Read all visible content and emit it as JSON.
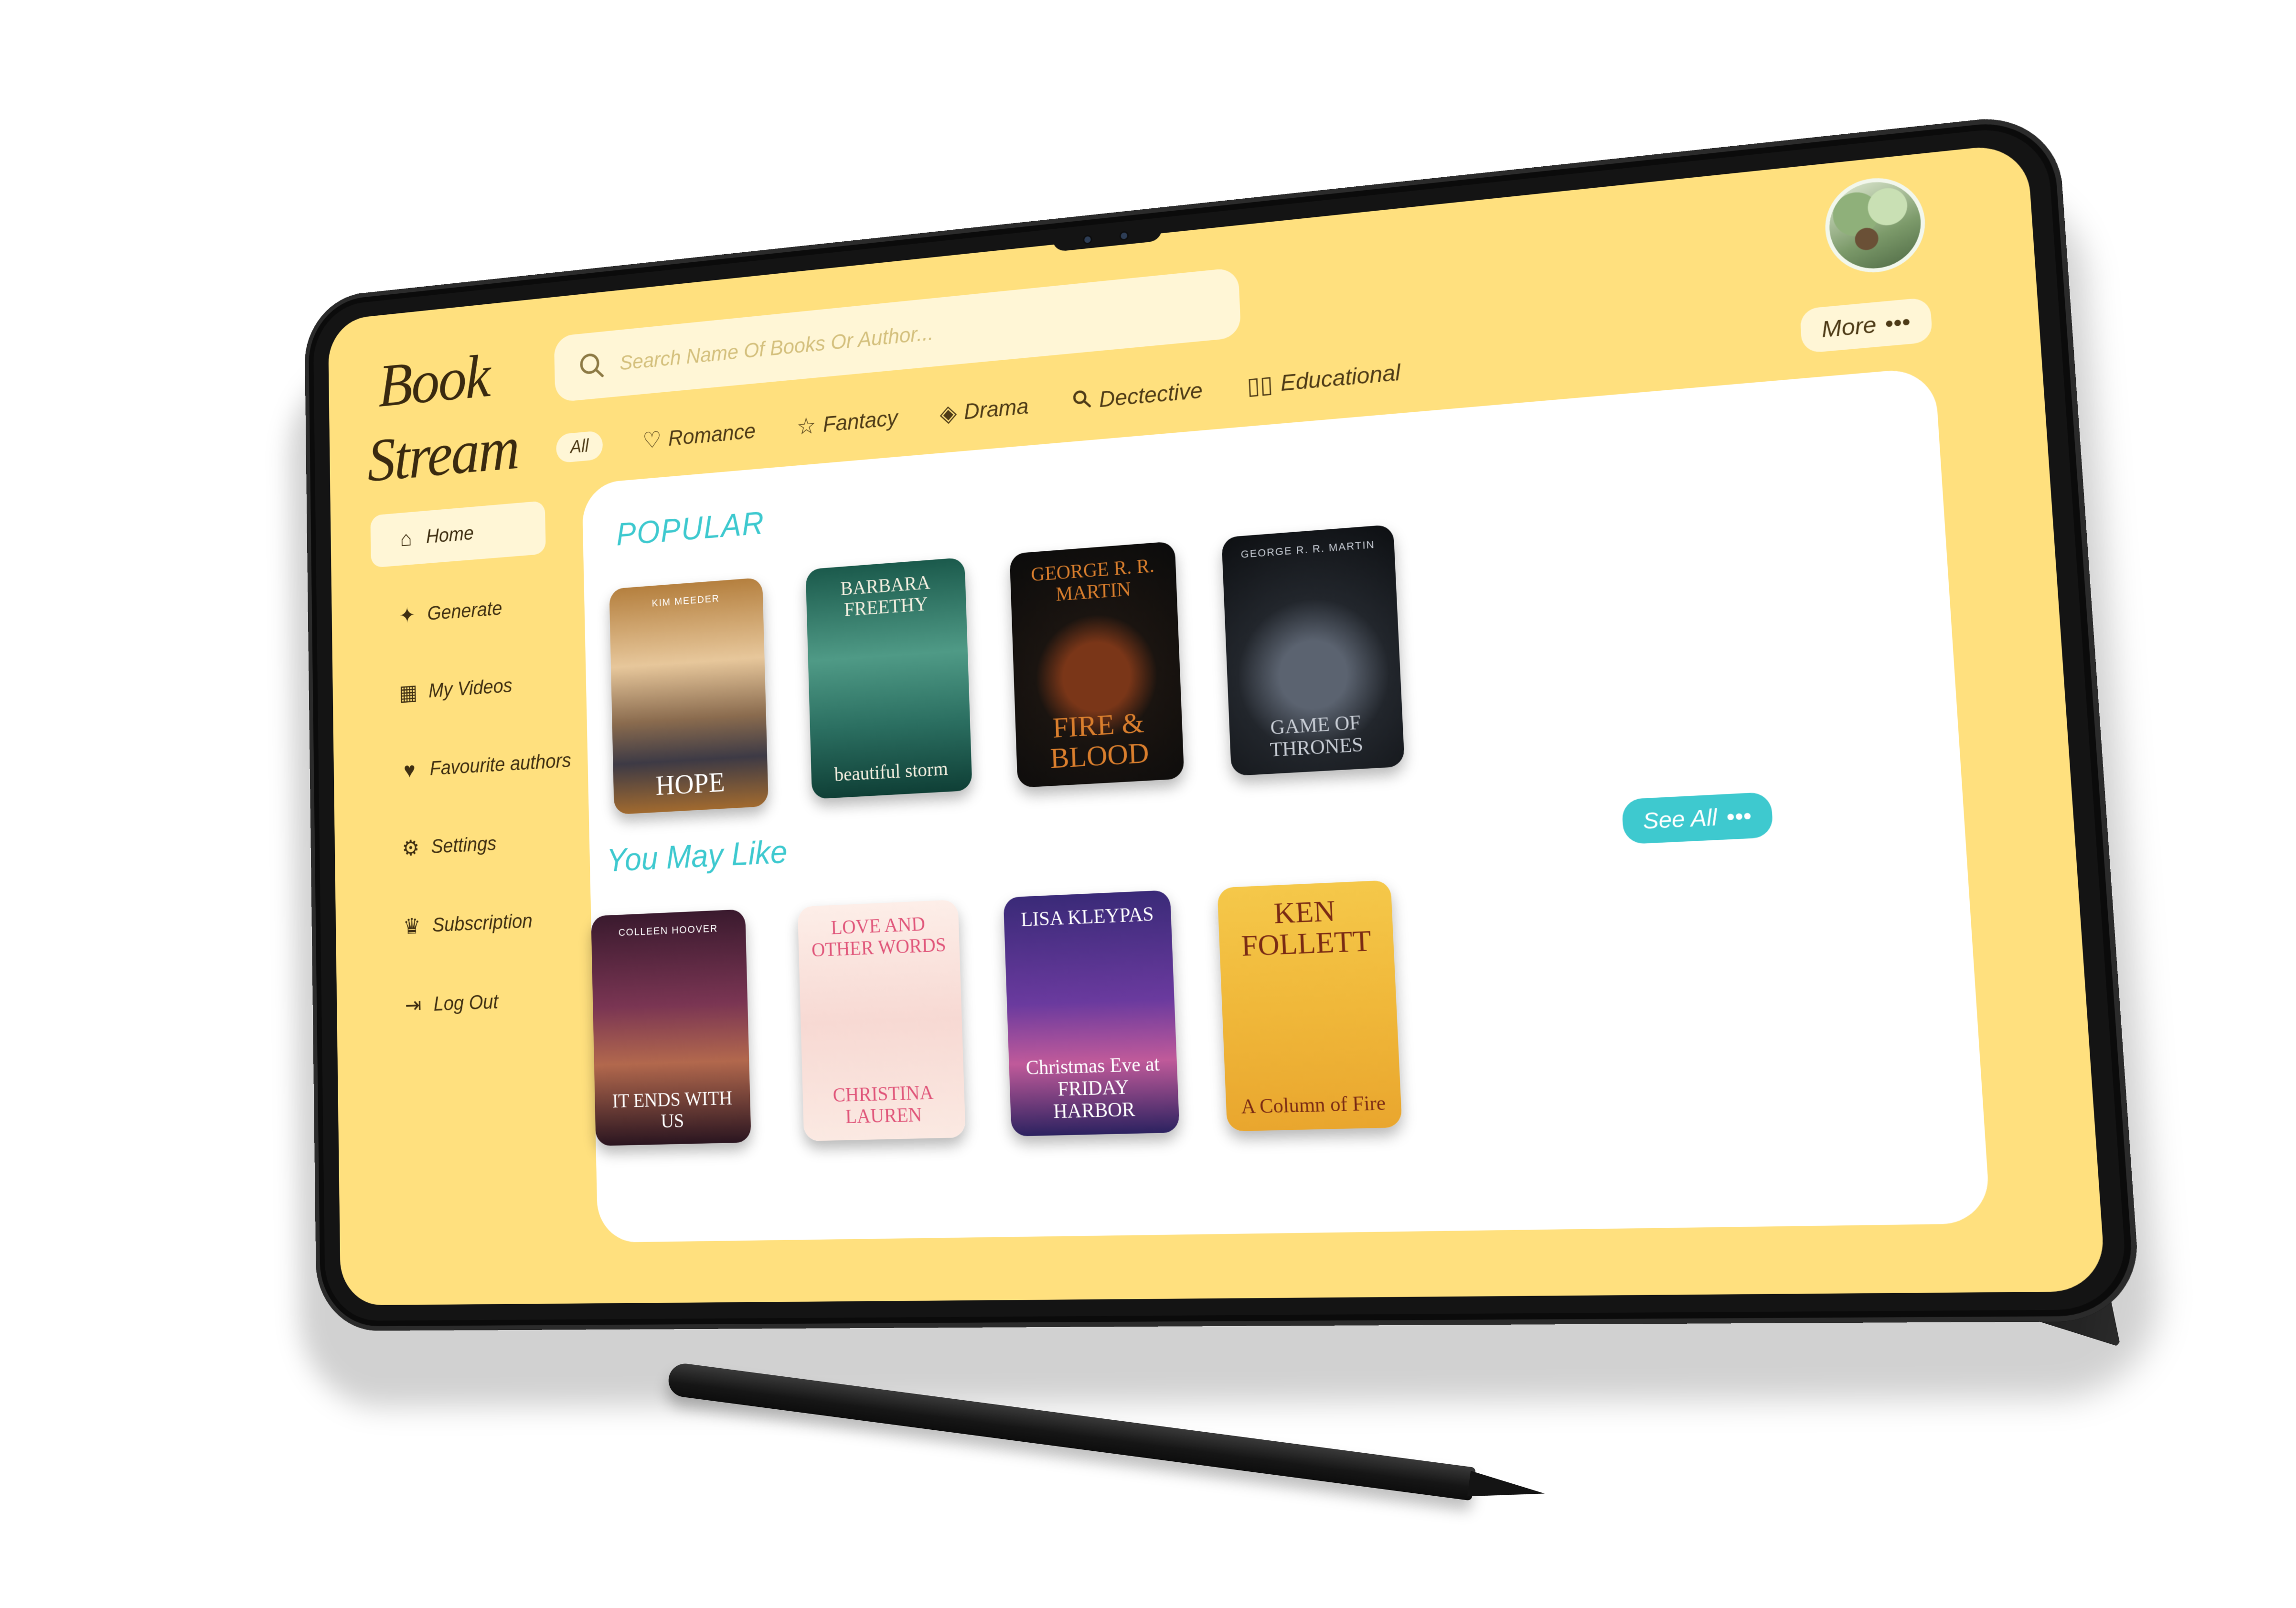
{
  "app": {
    "logo_line1": "Book",
    "logo_line2": "Stream"
  },
  "search": {
    "placeholder": "Search Name Of Books Or Author..."
  },
  "categories": [
    {
      "label": "All",
      "icon": ""
    },
    {
      "label": "Romance",
      "icon": "heart-outline-icon"
    },
    {
      "label": "Fantacy",
      "icon": "star-outline-icon"
    },
    {
      "label": "Drama",
      "icon": "mask-icon"
    },
    {
      "label": "Dectective",
      "icon": "search-icon"
    },
    {
      "label": "Educational",
      "icon": "open-book-icon"
    }
  ],
  "more_label": "More",
  "sidebar": {
    "items": [
      {
        "label": "Home",
        "icon": "home-icon",
        "active": true
      },
      {
        "label": "Generate",
        "icon": "sparkle-icon"
      },
      {
        "label": "My Videos",
        "icon": "clapperboard-icon"
      },
      {
        "label": "Favourite authors",
        "icon": "heart-icon"
      },
      {
        "label": "Settings",
        "icon": "gear-icon"
      },
      {
        "label": "Subscription",
        "icon": "crown-icon"
      },
      {
        "label": "Log Out",
        "icon": "logout-icon"
      }
    ]
  },
  "sections": {
    "popular_title": "POPULAR",
    "like_title": "You May Like",
    "see_all_label": "See All"
  },
  "books": {
    "popular": [
      {
        "title": "HOPE",
        "author": "KIM MEEDER"
      },
      {
        "title": "beautiful storm",
        "author": "BARBARA FREETHY"
      },
      {
        "title": "FIRE & BLOOD",
        "author": "GEORGE R. R. MARTIN"
      },
      {
        "title": "GAME OF THRONES",
        "author": "GEORGE R. R. MARTIN"
      }
    ],
    "you_may_like": [
      {
        "title": "IT ENDS WITH US",
        "author": "COLLEEN HOOVER"
      },
      {
        "title": "LOVE AND OTHER WORDS",
        "author": "CHRISTINA LAUREN"
      },
      {
        "title": "Christmas Eve at FRIDAY HARBOR",
        "author": "LISA KLEYPAS"
      },
      {
        "title": "A Column of Fire",
        "author": "KEN FOLLETT"
      }
    ]
  },
  "colors": {
    "screen_bg": "#ffe07e",
    "panel_bg": "#ffffff",
    "pill_bg": "#fff6d6",
    "accent_teal": "#3ec9cf",
    "text_brown": "#4e3b17"
  }
}
